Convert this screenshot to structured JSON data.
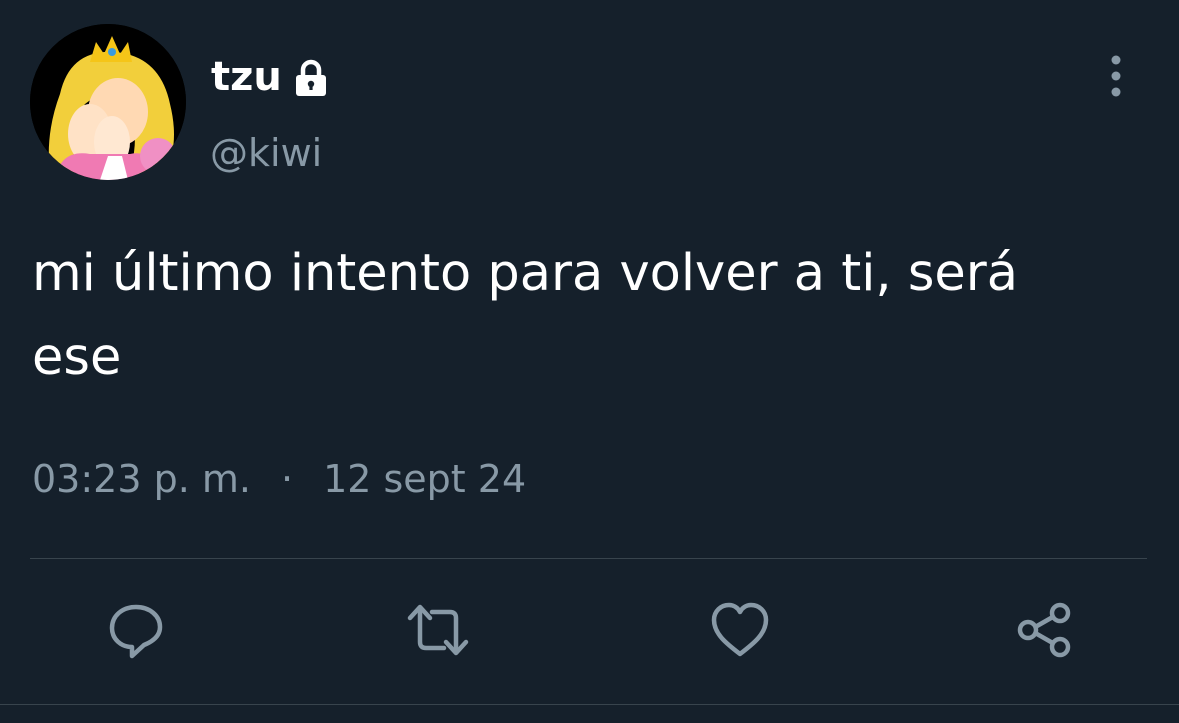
{
  "author": {
    "display_name": "tzu",
    "handle": "@kiwi",
    "protected_icon": "lock-icon",
    "avatar": "avatar"
  },
  "tweet": {
    "text": "mi último intento para volver a ti, será\nese",
    "time": "03:23 p. m.",
    "separator": "·",
    "date": "12 sept 24"
  },
  "actions": [
    {
      "name": "reply",
      "icon": "reply-icon"
    },
    {
      "name": "retweet",
      "icon": "retweet-icon"
    },
    {
      "name": "like",
      "icon": "heart-icon"
    },
    {
      "name": "share",
      "icon": "share-icon"
    }
  ],
  "colors": {
    "background": "#15202b",
    "primary_text": "#ffffff",
    "secondary_text": "#8899a6",
    "divider": "#38444d"
  }
}
